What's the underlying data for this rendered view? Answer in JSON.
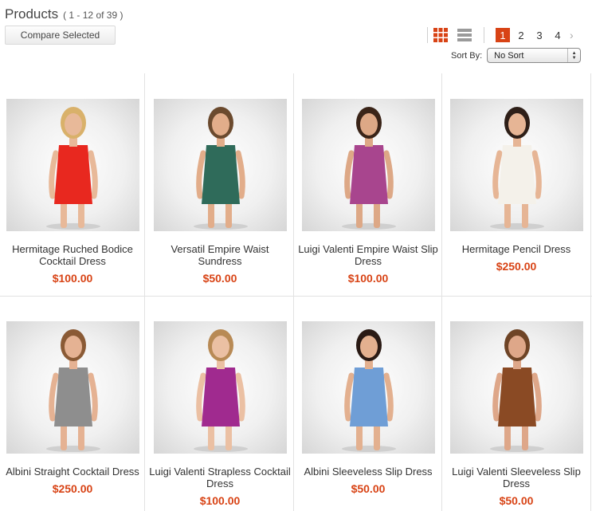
{
  "header": {
    "title": "Products",
    "count": "( 1 - 12 of 39 )",
    "compare_label": "Compare Selected"
  },
  "view": {
    "grid_icon": "grid-view-icon",
    "list_icon": "list-view-icon",
    "active": "grid"
  },
  "pagination": {
    "pages": [
      "1",
      "2",
      "3",
      "4"
    ],
    "current": "1",
    "next_icon": "chevron-right-icon"
  },
  "sort": {
    "label": "Sort By:",
    "value": "No Sort"
  },
  "colors": {
    "accent": "#d84315",
    "border": "#e2e2e2"
  },
  "products": [
    {
      "name": "Hermitage Ruched Bodice Cocktail Dress",
      "price": "$100.00",
      "dress_color": "#e8281f",
      "hair_color": "#d9b16a",
      "skin_color": "#e8b999"
    },
    {
      "name": "Versatil Empire Waist Sundress",
      "price": "$50.00",
      "dress_color": "#2f6b5a",
      "hair_color": "#6b4a2e",
      "skin_color": "#e2ad8a"
    },
    {
      "name": "Luigi Valenti Empire Waist Slip Dress",
      "price": "$100.00",
      "dress_color": "#a8458e",
      "hair_color": "#3a2418",
      "skin_color": "#dda886"
    },
    {
      "name": "Hermitage Pencil Dress",
      "price": "$250.00",
      "dress_color": "#f4f1ea",
      "hair_color": "#2e1f18",
      "skin_color": "#e6b595"
    },
    {
      "name": "Albini Straight Cocktail Dress",
      "price": "$250.00",
      "dress_color": "#8e8e8e",
      "hair_color": "#8a5a35",
      "skin_color": "#e5b293"
    },
    {
      "name": "Luigi Valenti Strapless Cocktail Dress",
      "price": "$100.00",
      "dress_color": "#a02a8f",
      "hair_color": "#b88a55",
      "skin_color": "#ebc0a3"
    },
    {
      "name": "Albini Sleeveless Slip Dress",
      "price": "$50.00",
      "dress_color": "#6f9ed6",
      "hair_color": "#2a1a14",
      "skin_color": "#e3b08f"
    },
    {
      "name": "Luigi Valenti Sleeveless Slip Dress",
      "price": "$50.00",
      "dress_color": "#8a4a24",
      "hair_color": "#6e4426",
      "skin_color": "#dea789"
    }
  ]
}
